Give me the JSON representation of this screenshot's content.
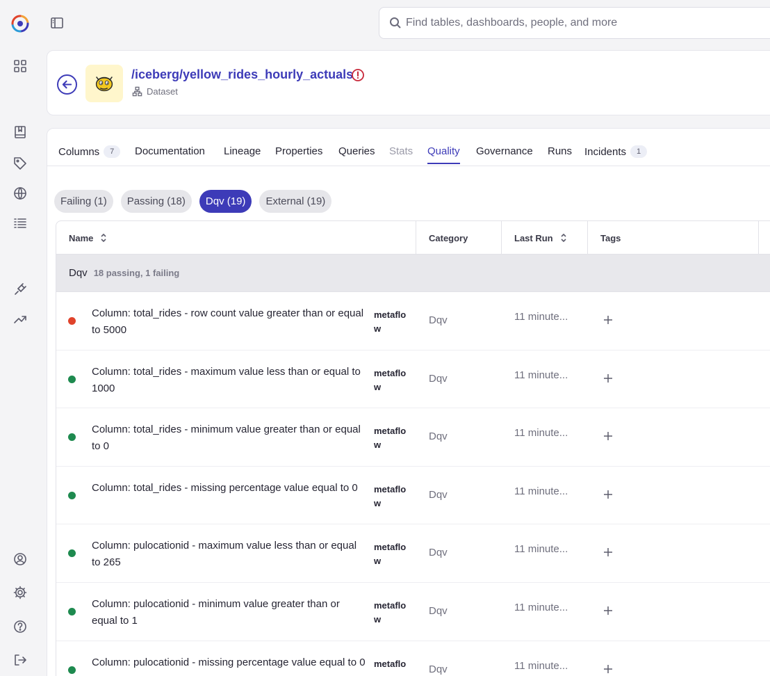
{
  "app": {
    "search_placeholder": "Find tables, dashboards, people, and more"
  },
  "dataset": {
    "name": "/iceberg/yellow_rides_hourly_actuals",
    "type": "Dataset"
  },
  "tabs": [
    {
      "label": "Columns",
      "count": "7"
    },
    {
      "label": "Documentation"
    },
    {
      "label": "Lineage"
    },
    {
      "label": "Properties"
    },
    {
      "label": "Queries"
    },
    {
      "label": "Stats"
    },
    {
      "label": "Quality"
    },
    {
      "label": "Governance"
    },
    {
      "label": "Runs"
    },
    {
      "label": "Incidents",
      "count": "1"
    }
  ],
  "filters": [
    "Failing (1)",
    "Passing (18)",
    "Dqv (19)",
    "External (19)"
  ],
  "table": {
    "headers": {
      "name": "Name",
      "category": "Category",
      "last_run": "Last Run",
      "tags": "Tags"
    },
    "group": {
      "name": "Dqv",
      "summary": "18 passing, 1 failing"
    },
    "rows": [
      {
        "status": "failing",
        "name": "Column: total_rides - row count value greater than or equal to 5000",
        "tool": "metaflow",
        "category": "Dqv",
        "last_run": "11 minute..."
      },
      {
        "status": "passing",
        "name": "Column: total_rides - maximum value less than or equal to 1000",
        "tool": "metaflow",
        "category": "Dqv",
        "last_run": "11 minute..."
      },
      {
        "status": "passing",
        "name": "Column: total_rides - minimum value greater than or equal to 0",
        "tool": "metaflow",
        "category": "Dqv",
        "last_run": "11 minute..."
      },
      {
        "status": "passing",
        "name": "Column: total_rides - missing percentage value equal to 0",
        "tool": "metaflow",
        "category": "Dqv",
        "last_run": "11 minute..."
      },
      {
        "status": "passing",
        "name": "Column: pulocationid - maximum value less than or equal to 265",
        "tool": "metaflow",
        "category": "Dqv",
        "last_run": "11 minute..."
      },
      {
        "status": "passing",
        "name": "Column: pulocationid - minimum value greater than or equal to 1",
        "tool": "metaflow",
        "category": "Dqv",
        "last_run": "11 minute..."
      },
      {
        "status": "passing",
        "name": "Column: pulocationid - missing percentage value equal to 0",
        "tool": "metaflow",
        "category": "Dqv",
        "last_run": "11 minute..."
      }
    ]
  },
  "colors": {
    "accent": "#3d3bb8",
    "pass": "#1e8a4f",
    "fail": "#e0432b"
  }
}
